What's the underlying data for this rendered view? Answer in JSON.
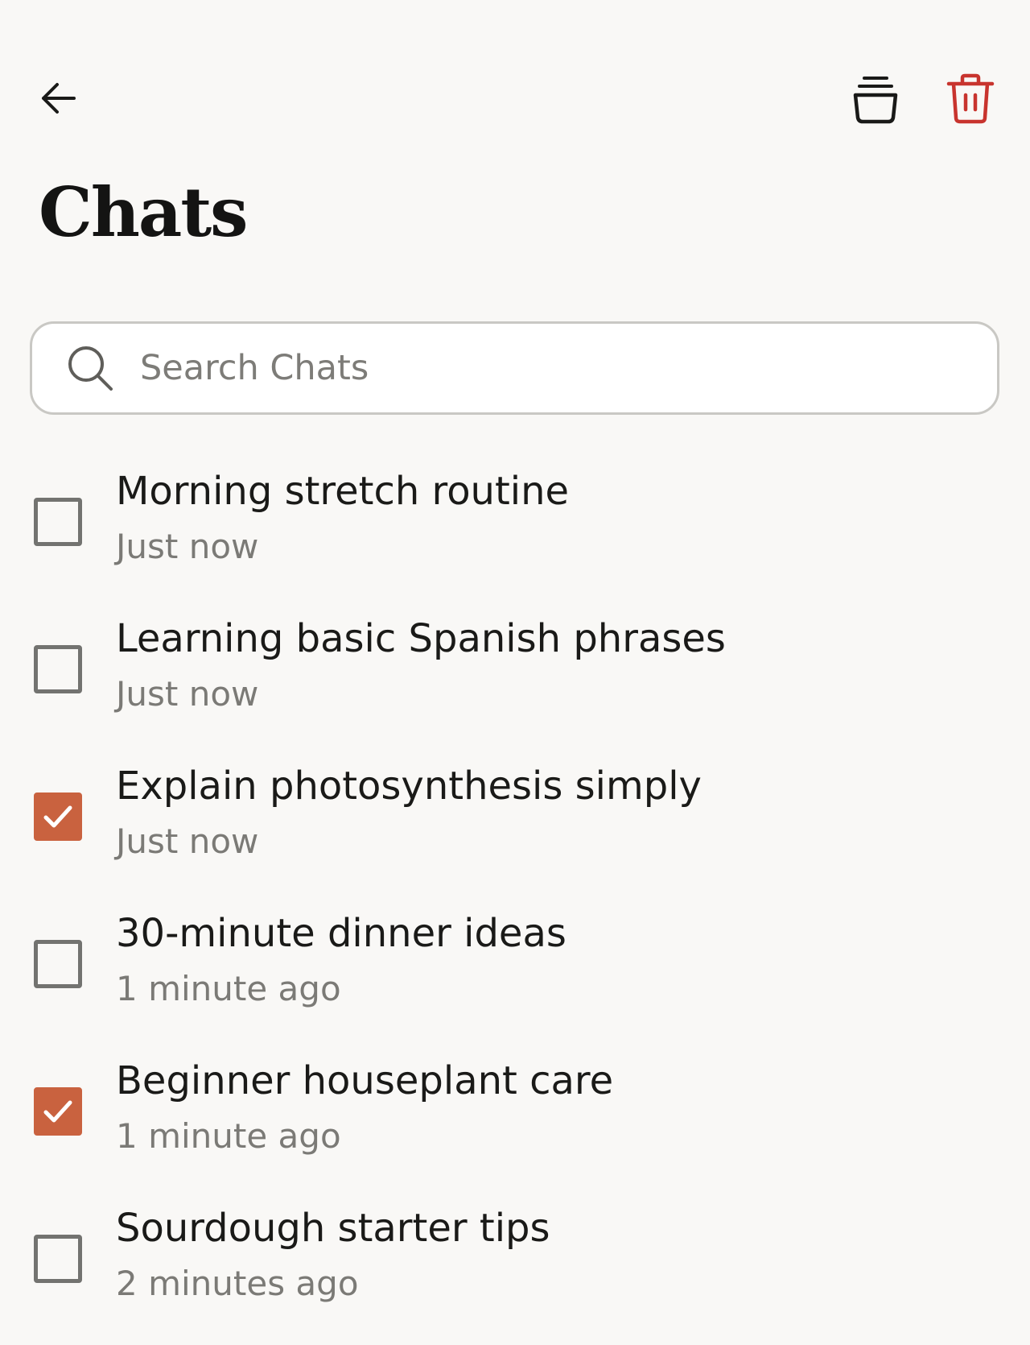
{
  "header": {
    "title": "Chats",
    "back_icon": "arrow-left-icon",
    "archive_icon": "archive-stack-icon",
    "delete_icon": "trash-icon",
    "delete_color": "#c8342e"
  },
  "search": {
    "placeholder": "Search Chats",
    "value": ""
  },
  "colors": {
    "background": "#f9f8f6",
    "accent": "#c9623f",
    "checkbox_border": "#737370",
    "secondary_text": "#7b7a76"
  },
  "chats": [
    {
      "title": "Morning stretch routine",
      "time": "Just now",
      "checked": false
    },
    {
      "title": "Learning basic Spanish phrases",
      "time": "Just now",
      "checked": false
    },
    {
      "title": "Explain photosynthesis simply",
      "time": "Just now",
      "checked": true
    },
    {
      "title": "30-minute dinner ideas",
      "time": "1 minute ago",
      "checked": false
    },
    {
      "title": "Beginner houseplant care",
      "time": "1 minute ago",
      "checked": true
    },
    {
      "title": "Sourdough starter tips",
      "time": "2 minutes ago",
      "checked": false
    }
  ]
}
